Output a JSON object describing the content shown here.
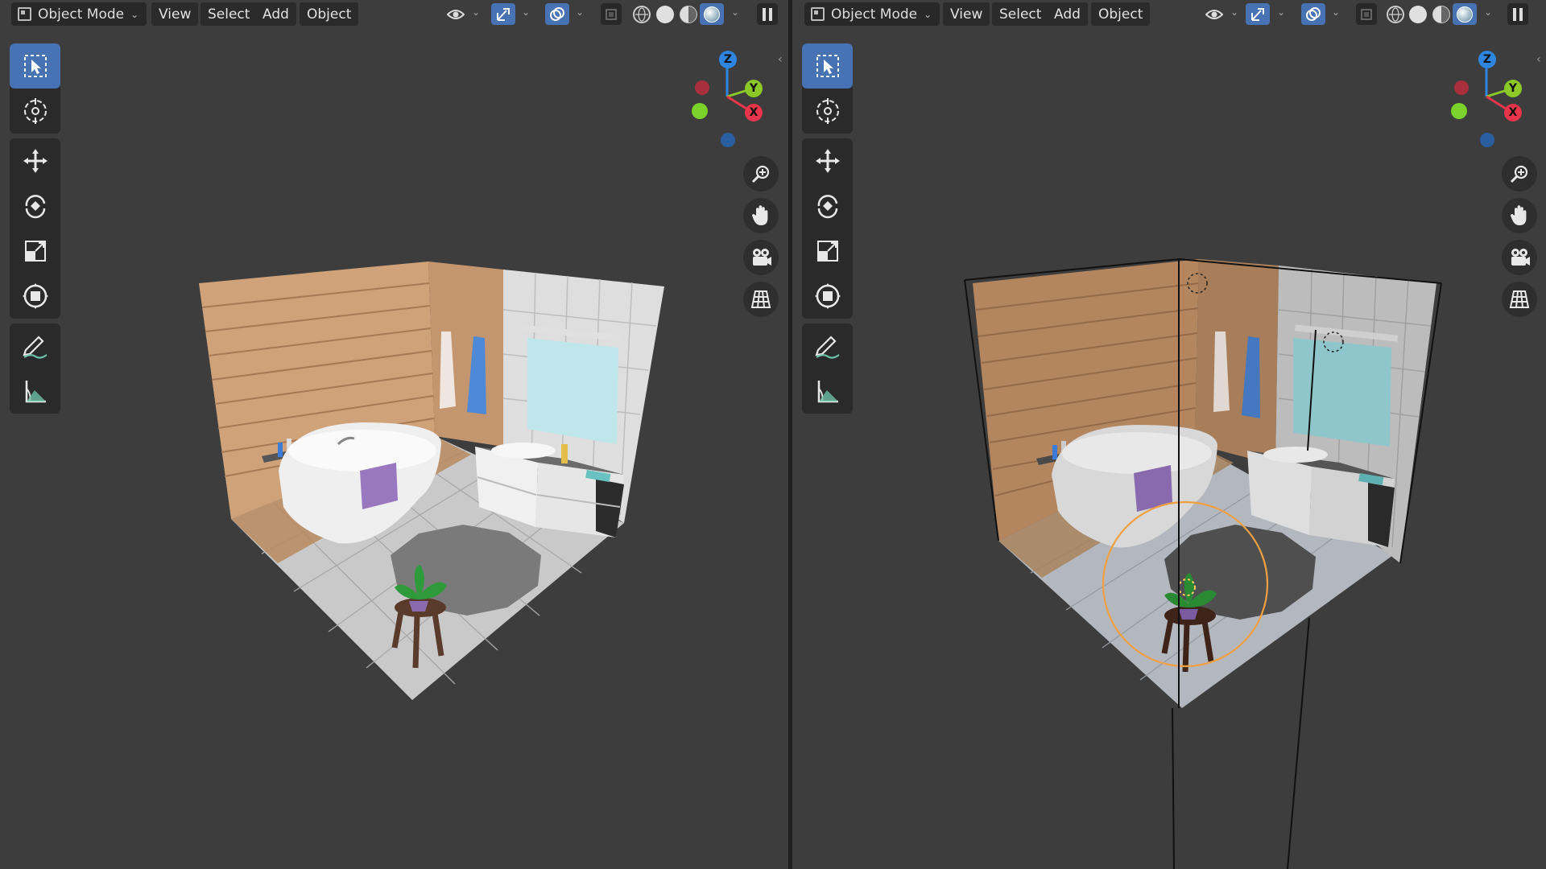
{
  "left": {
    "mode_label": "Object Mode",
    "menus": [
      "View",
      "Select",
      "Add",
      "Object"
    ]
  },
  "right": {
    "mode_label": "Object Mode",
    "menus": [
      "View",
      "Select",
      "Add",
      "Object"
    ]
  },
  "gizmo_axes": {
    "z": "Z",
    "y": "Y",
    "x": "X"
  },
  "tools": [
    "select-box",
    "cursor",
    "move",
    "rotate",
    "scale",
    "transform",
    "annotate",
    "measure"
  ],
  "nav_icons": [
    "zoom-icon",
    "pan-hand-icon",
    "camera-icon",
    "ortho-grid-icon"
  ],
  "colors": {
    "viewport_bg": "#3d3d3d",
    "active_blue": "#4772b3",
    "axis_x": "#e8354b",
    "axis_y": "#8cc928",
    "axis_z": "#2e86e0",
    "selection_outline": "#f0a040"
  },
  "shading": {
    "left_active": "rendered",
    "right_active": "rendered"
  }
}
